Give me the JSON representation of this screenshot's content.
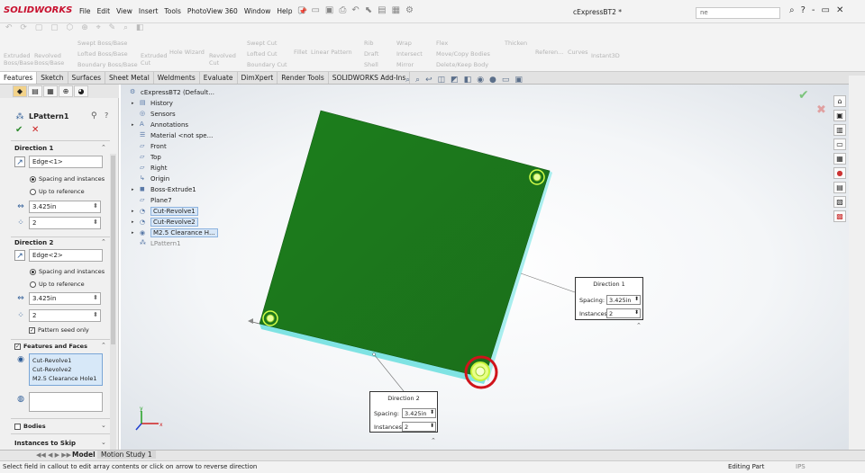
{
  "app": {
    "logo": "SOLIDWORKS",
    "document_title": "cExpressBT2 *",
    "search_placeholder": "ne",
    "window_controls": [
      "?",
      "-",
      "▭",
      "✕"
    ]
  },
  "menu": [
    "File",
    "Edit",
    "View",
    "Insert",
    "Tools",
    "PhotoView 360",
    "Window",
    "Help"
  ],
  "command_manager": [
    {
      "label": "Extruded\nBoss/Base"
    },
    {
      "label": "Revolved\nBoss/Base"
    },
    {
      "label": "Swept Boss/Base"
    },
    {
      "label": "Lofted Boss/Base"
    },
    {
      "label": "Boundary Boss/Base"
    },
    {
      "label": "Extruded\nCut"
    },
    {
      "label": "Hole Wizard"
    },
    {
      "label": "Revolved\nCut"
    },
    {
      "label": "Swept Cut"
    },
    {
      "label": "Lofted Cut"
    },
    {
      "label": "Boundary Cut"
    },
    {
      "label": "Fillet"
    },
    {
      "label": "Linear Pattern"
    },
    {
      "label": "Rib"
    },
    {
      "label": "Draft"
    },
    {
      "label": "Shell"
    },
    {
      "label": "Wrap"
    },
    {
      "label": "Intersect"
    },
    {
      "label": "Mirror"
    },
    {
      "label": "Flex"
    },
    {
      "label": "Move/Copy Bodies"
    },
    {
      "label": "Delete/Keep Body"
    },
    {
      "label": "Thicken"
    },
    {
      "label": "Referen..."
    },
    {
      "label": "Curves"
    },
    {
      "label": "Instant3D"
    }
  ],
  "tabs": [
    "Features",
    "Sketch",
    "Surfaces",
    "Sheet Metal",
    "Weldments",
    "Evaluate",
    "DimXpert",
    "Render Tools",
    "SOLIDWORKS Add-Ins"
  ],
  "property_manager": {
    "title": "LPattern1",
    "ok": "✔",
    "cancel": "✕",
    "direction1": {
      "title": "Direction 1",
      "edge": "Edge<1>",
      "radio1": "Spacing and instances",
      "radio2": "Up to reference",
      "spacing": "3.425in",
      "instances": "2"
    },
    "direction2": {
      "title": "Direction 2",
      "edge": "Edge<2>",
      "radio1": "Spacing and instances",
      "radio2": "Up to reference",
      "spacing": "3.425in",
      "instances": "2",
      "seed_only": "Pattern seed only"
    },
    "features_and_faces": {
      "title": "Features and Faces",
      "items": [
        "Cut-Revolve1",
        "Cut-Revolve2",
        "M2.5 Clearance Hole1"
      ]
    },
    "bodies": "Bodies",
    "instances_to_skip": "Instances to Skip"
  },
  "tree": [
    {
      "label": "cExpressBT2  (Default..."
    },
    {
      "label": "History"
    },
    {
      "label": "Sensors"
    },
    {
      "label": "Annotations"
    },
    {
      "label": "Material <not spe..."
    },
    {
      "label": "Front"
    },
    {
      "label": "Top"
    },
    {
      "label": "Right"
    },
    {
      "label": "Origin"
    },
    {
      "label": "Boss-Extrude1"
    },
    {
      "label": "Plane7"
    },
    {
      "label": "Cut-Revolve1"
    },
    {
      "label": "Cut-Revolve2"
    },
    {
      "label": "M2.5 Clearance H..."
    },
    {
      "label": "LPattern1"
    }
  ],
  "callout1": {
    "title": "Direction 1",
    "spacing_label": "Spacing:",
    "spacing": "3.425in",
    "instances_label": "Instances:",
    "instances": "2"
  },
  "callout2": {
    "title": "Direction 2",
    "spacing_label": "Spacing:",
    "spacing": "3.425in",
    "instances_label": "Instances:",
    "instances": "2"
  },
  "bottom_tabs": [
    "Model",
    "Motion Study 1"
  ],
  "status": {
    "message": "Select field in callout to edit array contents or click on arrow to reverse direction",
    "mode": "Editing Part",
    "units": "IPS"
  },
  "colors": {
    "part_green": "#1f7a1f",
    "edge_cyan": "#5fd6d6",
    "seed_ring": "#d4ff4a",
    "highlight_circle": "#d0141b"
  }
}
